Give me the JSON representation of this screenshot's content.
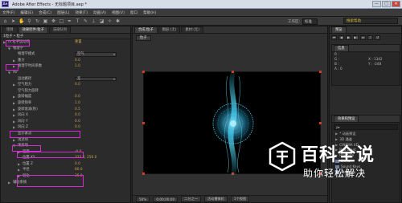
{
  "window": {
    "title": "Adobe After Effects - 无标题项目.aep *",
    "app_icon": "Ae",
    "controls": [
      "—",
      "□",
      "✕"
    ]
  },
  "menu": [
    "文件(F)",
    "编辑(E)",
    "合成(C)",
    "图层(L)",
    "效果(T)",
    "动画(A)",
    "视图(V)",
    "窗口",
    "帮助(H)"
  ],
  "toolbar": {
    "workspace_label": "工作区:",
    "workspace_value": "标准",
    "search_placeholder": "搜索帮助"
  },
  "effects_panel": {
    "tabs": [
      "项目",
      "效果控件:粒子",
      "渲染队列"
    ],
    "breadcrumb": "1粒子 • 粒子",
    "rows": [
      {
        "depth": 0,
        "twirl": "▶",
        "label": "fx 粒子运动场",
        "value": "重置"
      },
      {
        "depth": 1,
        "twirl": "▼",
        "label": "物理学"
      },
      {
        "depth": 2,
        "twirl": "",
        "label": "物理学模式",
        "value": "空气",
        "dropdown": true
      },
      {
        "depth": 2,
        "twirl": "▶",
        "label": "重力",
        "value": "0.0"
      },
      {
        "depth": 2,
        "twirl": "▶",
        "label": "物理学时间系数",
        "value": "1.0"
      },
      {
        "depth": 1,
        "twirl": "▼",
        "label": "Air"
      },
      {
        "depth": 2,
        "twirl": "",
        "label": "运动路径",
        "value": "无",
        "dropdown": true
      },
      {
        "depth": 2,
        "twirl": "▶",
        "label": "空气阻力",
        "value": "0.0"
      },
      {
        "depth": 2,
        "twirl": "",
        "label": "空气阻力旋转"
      },
      {
        "depth": 2,
        "twirl": "▶",
        "label": "旋转幅度",
        "value": "0.0"
      },
      {
        "depth": 2,
        "twirl": "▶",
        "label": "旋转频率",
        "value": "1.0"
      },
      {
        "depth": 2,
        "twirl": "▶",
        "label": "旋转衰减(秒)",
        "value": "0.5"
      },
      {
        "depth": 2,
        "twirl": "▶",
        "label": "风向 X",
        "value": "0.0"
      },
      {
        "depth": 2,
        "twirl": "▶",
        "label": "风向 Y",
        "value": "0.0"
      },
      {
        "depth": 2,
        "twirl": "▶",
        "label": "风向 Z",
        "value": "0.0"
      },
      {
        "depth": 2,
        "twirl": "",
        "label": "显示紊流"
      },
      {
        "depth": 2,
        "twirl": "▶",
        "label": "湍流场"
      },
      {
        "depth": 2,
        "twirl": "▼",
        "label": "球形场"
      },
      {
        "depth": 3,
        "twirl": "▶",
        "label": "强度",
        "value": "-0.0"
      },
      {
        "depth": 3,
        "twirl": "",
        "label": "位置 XY",
        "value": "333.3, 256.0"
      },
      {
        "depth": 3,
        "twirl": "▶",
        "label": "位置 Z",
        "value": "0.0"
      },
      {
        "depth": 3,
        "twirl": "▶",
        "label": "半径",
        "value": "80.0"
      },
      {
        "depth": 3,
        "twirl": "▶",
        "label": "羽化",
        "value": "36.0"
      },
      {
        "depth": 1,
        "twirl": "▶",
        "label": "辅助系统"
      }
    ]
  },
  "preview_panel": {
    "tabs": [
      "合成:粒子",
      "图层:(无)",
      "素材:(无)"
    ],
    "comp_label": "粒子",
    "zoom": "50%",
    "time": "0;00;00;00",
    "quality": "二分之一",
    "camera": "活动摄像机",
    "views": "1个视图"
  },
  "right_panel": {
    "preview_tab": "预览",
    "info_tab": "信息",
    "info_lines": [
      "R :",
      "G :",
      "B :",
      "A : 0",
      "X : 1342",
      "Y : -248"
    ],
    "effects_tab": "效果和预设",
    "search_value": "ρ▸",
    "effects_list": [
      {
        "label": "* 动画预设"
      },
      {
        "label": "3D 通道"
      },
      {
        "label": "CINEMA 4D"
      },
      {
        "label": "Red Giant"
      },
      {
        "label": "Rowbyte"
      },
      {
        "label": "Shine",
        "icon": true
      },
      {
        "label": "Sound Keys",
        "icon": true
      },
      {
        "label": "Starglow",
        "icon": true
      }
    ]
  },
  "watermark": {
    "title": "百科全说",
    "subtitle": "助你轻松解决"
  },
  "colors": {
    "highlight": "#d22bd6",
    "particle": "#3ec7e6",
    "accent_value": "#c9a04a"
  }
}
